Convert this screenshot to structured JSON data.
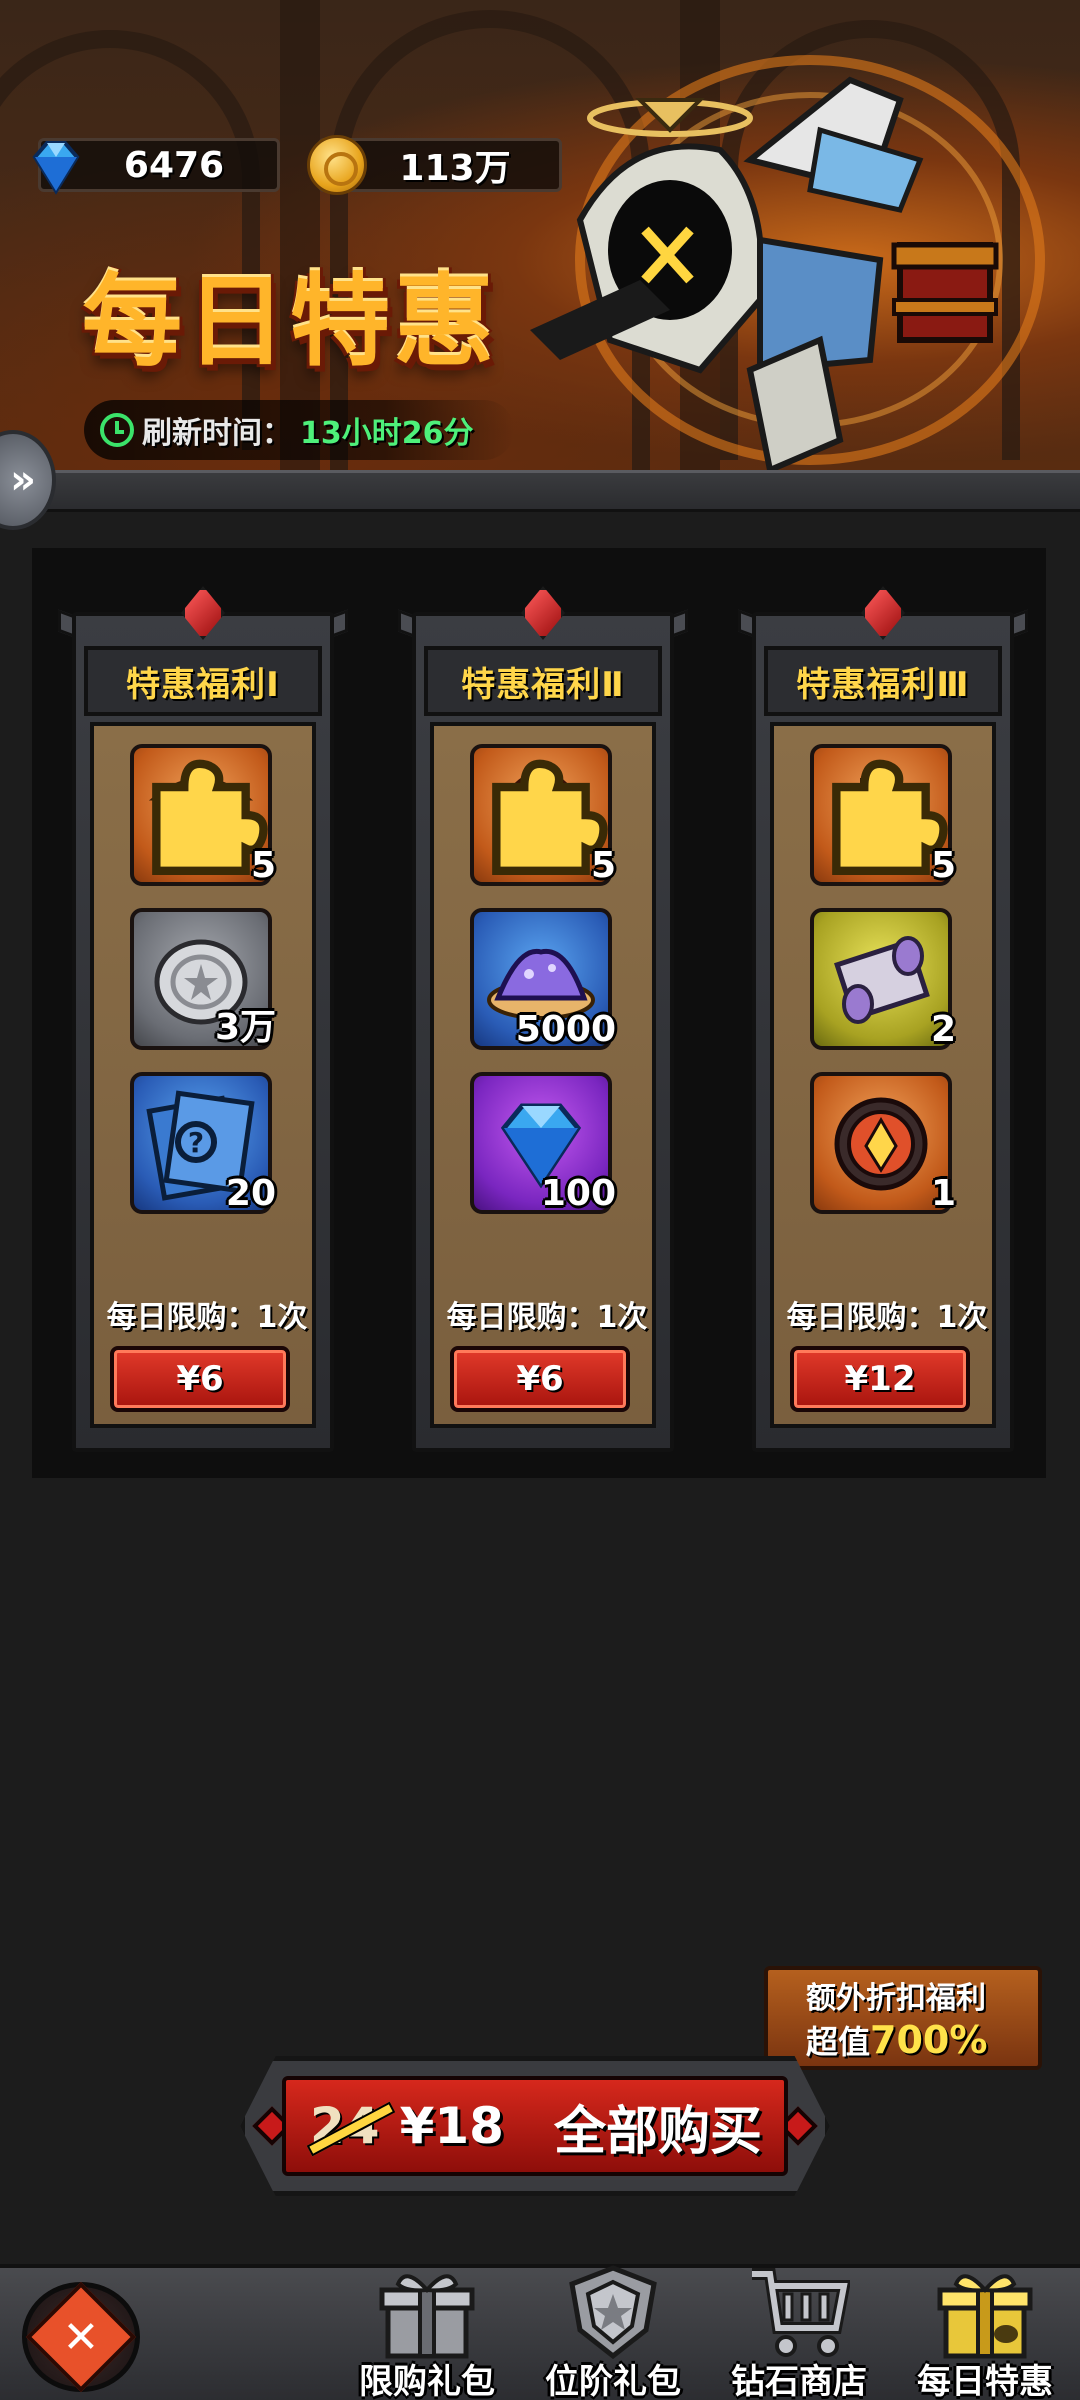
{
  "currency": {
    "gems": "6476",
    "coins": "113万"
  },
  "header": {
    "title": "每日特惠",
    "refresh_label": "刷新时间：",
    "refresh_time": "13小时26分"
  },
  "offers": [
    {
      "title": "特惠福利Ⅰ",
      "items": [
        {
          "icon": "treasure-chest-icon",
          "qty": "5",
          "bg": "orange",
          "puzzle": true
        },
        {
          "icon": "silver-coin-icon",
          "qty": "3万",
          "bg": "grey",
          "puzzle": false
        },
        {
          "icon": "mystery-card-icon",
          "qty": "20",
          "bg": "blue",
          "puzzle": false
        }
      ],
      "limit": "每日限购：1次",
      "price": "¥6"
    },
    {
      "title": "特惠福利Ⅱ",
      "items": [
        {
          "icon": "egg-icon",
          "qty": "5",
          "bg": "orange",
          "puzzle": true
        },
        {
          "icon": "crystal-dust-icon",
          "qty": "5000",
          "bg": "blue",
          "puzzle": false
        },
        {
          "icon": "diamond-icon",
          "qty": "100",
          "bg": "purple",
          "puzzle": false
        }
      ],
      "limit": "每日限购：1次",
      "price": "¥6"
    },
    {
      "title": "特惠福利Ⅲ",
      "items": [
        {
          "icon": "loot-bag-icon",
          "qty": "5",
          "bg": "orange",
          "puzzle": true
        },
        {
          "icon": "scroll-icon",
          "qty": "2",
          "bg": "yellow",
          "puzzle": false
        },
        {
          "icon": "hero-emblem-icon",
          "qty": "1",
          "bg": "orange",
          "puzzle": false
        }
      ],
      "limit": "每日限购：1次",
      "price": "¥12"
    }
  ],
  "bonus": {
    "line1": "额外折扣福利",
    "line2_prefix": "超值",
    "line2_value": "700%"
  },
  "buy_all": {
    "old_price": "24",
    "new_price": "¥18",
    "label": "全部购买"
  },
  "nav": [
    {
      "label": "限购礼包",
      "icon": "gift-box-icon"
    },
    {
      "label": "位阶礼包",
      "icon": "rank-shield-icon"
    },
    {
      "label": "钻石商店",
      "icon": "shopping-cart-icon"
    },
    {
      "label": "每日特惠",
      "icon": "daily-gift-icon",
      "active": true
    }
  ],
  "colors": {
    "accent_gold": "#ffb52a",
    "price_red": "#d6281c",
    "timer_green": "#4ef07a",
    "card_body": "#8a6e48"
  }
}
